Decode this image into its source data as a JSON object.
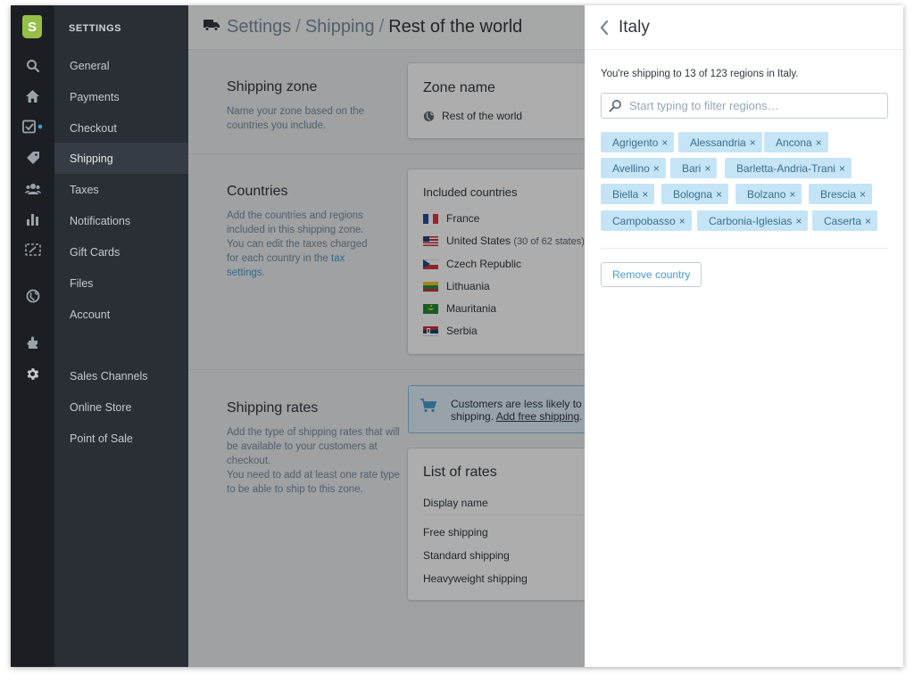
{
  "sidebar": {
    "title": "SETTINGS",
    "items": [
      {
        "label": "General"
      },
      {
        "label": "Payments"
      },
      {
        "label": "Checkout"
      },
      {
        "label": "Shipping",
        "active": true
      },
      {
        "label": "Taxes"
      },
      {
        "label": "Notifications"
      },
      {
        "label": "Gift Cards"
      },
      {
        "label": "Files"
      },
      {
        "label": "Account"
      }
    ],
    "channels": [
      {
        "label": "Sales Channels"
      },
      {
        "label": "Online Store"
      },
      {
        "label": "Point of Sale"
      }
    ]
  },
  "breadcrumb": {
    "items": [
      "Settings",
      "Shipping"
    ],
    "current": "Rest of the world",
    "separator": "/"
  },
  "zone": {
    "title": "Shipping zone",
    "description": "Name your zone based on the countries you include.",
    "card_title": "Zone name",
    "zone_value": "Rest of the world"
  },
  "countries": {
    "title": "Countries",
    "description": "Add the countries and regions included in this shipping zone. You can edit the taxes charged for each country in the",
    "link": "tax settings",
    "after_link": ".",
    "card_title": "Included countries",
    "list": [
      {
        "name": "France",
        "note": ""
      },
      {
        "name": "United States",
        "note": "(30 of 62 states)"
      },
      {
        "name": "Czech Republic",
        "note": ""
      },
      {
        "name": "Lithuania",
        "note": ""
      },
      {
        "name": "Mauritania",
        "note": ""
      },
      {
        "name": "Serbia",
        "note": ""
      }
    ]
  },
  "rates": {
    "title": "Shipping rates",
    "description": "Add the type of shipping rates that will be available to your customers at checkout.",
    "description2": "You need to add at least one rate type to be able to ship to this zone.",
    "banner_text": "Customers are less likely to a",
    "banner_text2": "shipping.",
    "banner_link": "Add free shipping",
    "banner_after": ".",
    "card_title": "List of rates",
    "column_header": "Display name",
    "list": [
      "Free shipping",
      "Standard shipping",
      "Heavyweight shipping"
    ]
  },
  "panel": {
    "title": "Italy",
    "info": "You're shipping to 13 of 123 regions in Italy.",
    "filter_placeholder": "Start typing to filter regions…",
    "tags": [
      "Agrigento",
      "Alessandria",
      "Ancona",
      "Avellino",
      "Bari",
      "Barletta-Andria-Trani",
      "Biella",
      "Bologna",
      "Bolzano",
      "Brescia",
      "Campobasso",
      "Carbonia-Iglesias",
      "Caserta"
    ],
    "tag_remove_glyph": "×",
    "remove_button": "Remove country"
  },
  "colors": {
    "rail": "#1b1f23",
    "nav": "#2a2f35",
    "accent": "#479ccf",
    "brand": "#95bf47",
    "tag": "#c5e5f7"
  },
  "icons": {
    "rail": [
      "shopify-logo-icon",
      "search-icon",
      "home-icon",
      "orders-icon",
      "products-icon",
      "customers-icon",
      "reports-icon",
      "discounts-icon",
      "globe-icon",
      "apps-icon",
      "settings-gear-icon"
    ]
  }
}
